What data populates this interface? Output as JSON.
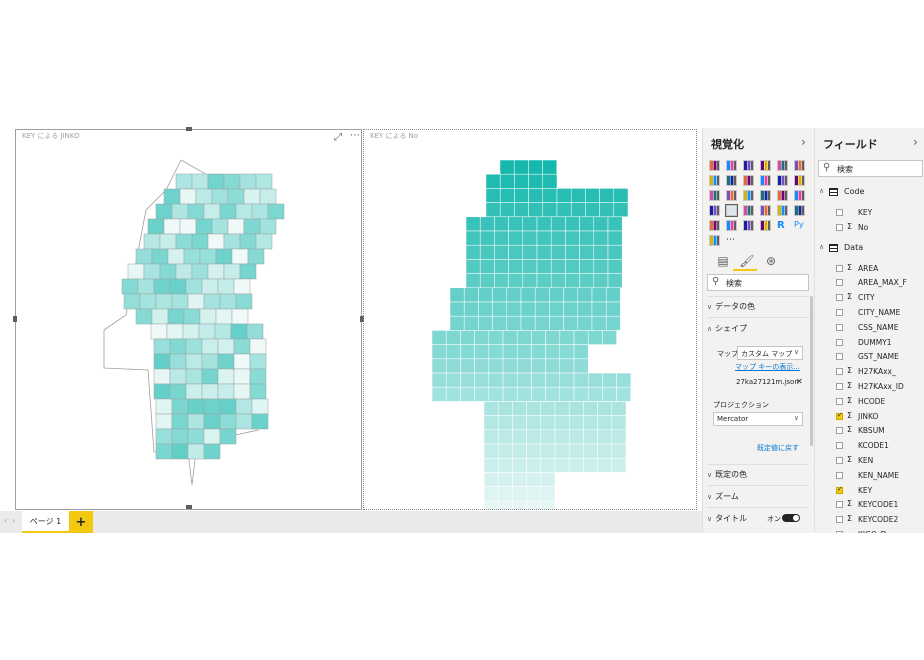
{
  "canvas": {
    "left_visual": {
      "title": "KEY による JINKO"
    },
    "right_visual": {
      "title": "KEY による No"
    }
  },
  "page_tabs": {
    "tab_label": "ページ 1",
    "add_label": "+"
  },
  "visualizations_pane": {
    "title": "視覚化",
    "chevron": "›",
    "search_placeholder": "検索",
    "format_sections": {
      "data_colors": "データの色",
      "shape": "シェイプ",
      "map_label": "マップ",
      "map_value": "カスタム マップ",
      "map_key_link": "マップ キーの表示...",
      "file_name": "27ka27121m.json",
      "remove_icon": "✕",
      "projection_label": "プロジェクション",
      "projection_value": "Mercator",
      "reset_link": "既定値に戻す",
      "default_colors": "既定の色",
      "zoom": "ズーム",
      "title": "タイトル",
      "title_toggle": "オン"
    }
  },
  "fields_pane": {
    "title": "フィールド",
    "chevron": "›",
    "search_placeholder": "検索",
    "tables": [
      {
        "name": "Code",
        "fields": [
          {
            "label": "KEY",
            "sigma": "",
            "checked": false
          },
          {
            "label": "No",
            "sigma": "Σ",
            "checked": false
          }
        ]
      },
      {
        "name": "Data",
        "fields": [
          {
            "label": "AREA",
            "sigma": "Σ",
            "checked": false
          },
          {
            "label": "AREA_MAX_F",
            "sigma": "",
            "checked": false
          },
          {
            "label": "CITY",
            "sigma": "Σ",
            "checked": false
          },
          {
            "label": "CITY_NAME",
            "sigma": "",
            "checked": false
          },
          {
            "label": "CSS_NAME",
            "sigma": "",
            "checked": false
          },
          {
            "label": "DUMMY1",
            "sigma": "",
            "checked": false
          },
          {
            "label": "GST_NAME",
            "sigma": "",
            "checked": false
          },
          {
            "label": "H27KAxx_",
            "sigma": "Σ",
            "checked": false
          },
          {
            "label": "H27KAxx_ID",
            "sigma": "Σ",
            "checked": false
          },
          {
            "label": "HCODE",
            "sigma": "Σ",
            "checked": false
          },
          {
            "label": "JINKO",
            "sigma": "Σ",
            "checked": true
          },
          {
            "label": "KBSUM",
            "sigma": "Σ",
            "checked": false
          },
          {
            "label": "KCODE1",
            "sigma": "",
            "checked": false
          },
          {
            "label": "KEN",
            "sigma": "Σ",
            "checked": false
          },
          {
            "label": "KEN_NAME",
            "sigma": "",
            "checked": false
          },
          {
            "label": "KEY",
            "sigma": "",
            "checked": true
          },
          {
            "label": "KEYCODE1",
            "sigma": "Σ",
            "checked": false
          },
          {
            "label": "KEYCODE2",
            "sigma": "Σ",
            "checked": false
          },
          {
            "label": "KIGO_D",
            "sigma": "",
            "checked": false
          }
        ]
      }
    ]
  },
  "colors": {
    "accent": "#f2c811",
    "map_dark": "#16b8ad",
    "map_light": "#eef9f8",
    "link": "#0078d4"
  }
}
